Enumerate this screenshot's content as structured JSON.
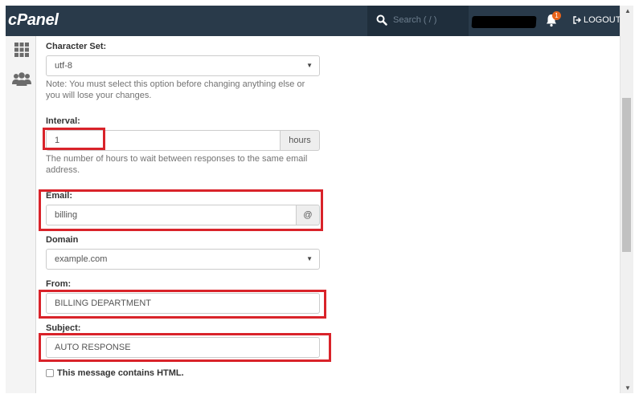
{
  "header": {
    "logo": "cPanel",
    "search_placeholder": "Search ( / )",
    "notification_count": "1",
    "logout_label": "LOGOUT"
  },
  "form": {
    "charset": {
      "label": "Character Set:",
      "value": "utf-8",
      "note": "Note: You must select this option before changing anything else or you will lose your changes."
    },
    "interval": {
      "label": "Interval:",
      "value": "1",
      "unit": "hours",
      "help": "The number of hours to wait between responses to the same email address."
    },
    "email": {
      "label": "Email:",
      "value": "billing",
      "addon": "@"
    },
    "domain": {
      "label": "Domain",
      "value": "example.com"
    },
    "from": {
      "label": "From:",
      "value": "BILLING DEPARTMENT"
    },
    "subject": {
      "label": "Subject:",
      "value": "AUTO RESPONSE"
    },
    "html_checkbox": {
      "label": "This message contains HTML.",
      "checked": false
    }
  },
  "colors": {
    "header_bg": "#293a4a",
    "highlight": "#d9232a",
    "badge": "#e8641b"
  }
}
